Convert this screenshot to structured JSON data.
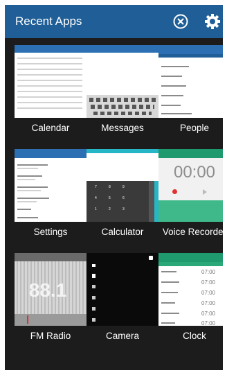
{
  "header": {
    "title": "Recent Apps",
    "background": "#1f5e96",
    "close_icon": "close-circle-icon",
    "settings_icon": "gear-icon"
  },
  "apps": [
    {
      "label": "Calendar"
    },
    {
      "label": "Messages"
    },
    {
      "label": "People"
    },
    {
      "label": "Settings"
    },
    {
      "label": "Calculator"
    },
    {
      "label": "Voice Recorder",
      "timer": "00:00"
    },
    {
      "label": "FM Radio",
      "frequency": "88.1"
    },
    {
      "label": "Camera"
    },
    {
      "label": "Clock",
      "times": [
        "07:00",
        "07:00",
        "07:00",
        "07:00",
        "07:00",
        "07:00"
      ]
    }
  ]
}
